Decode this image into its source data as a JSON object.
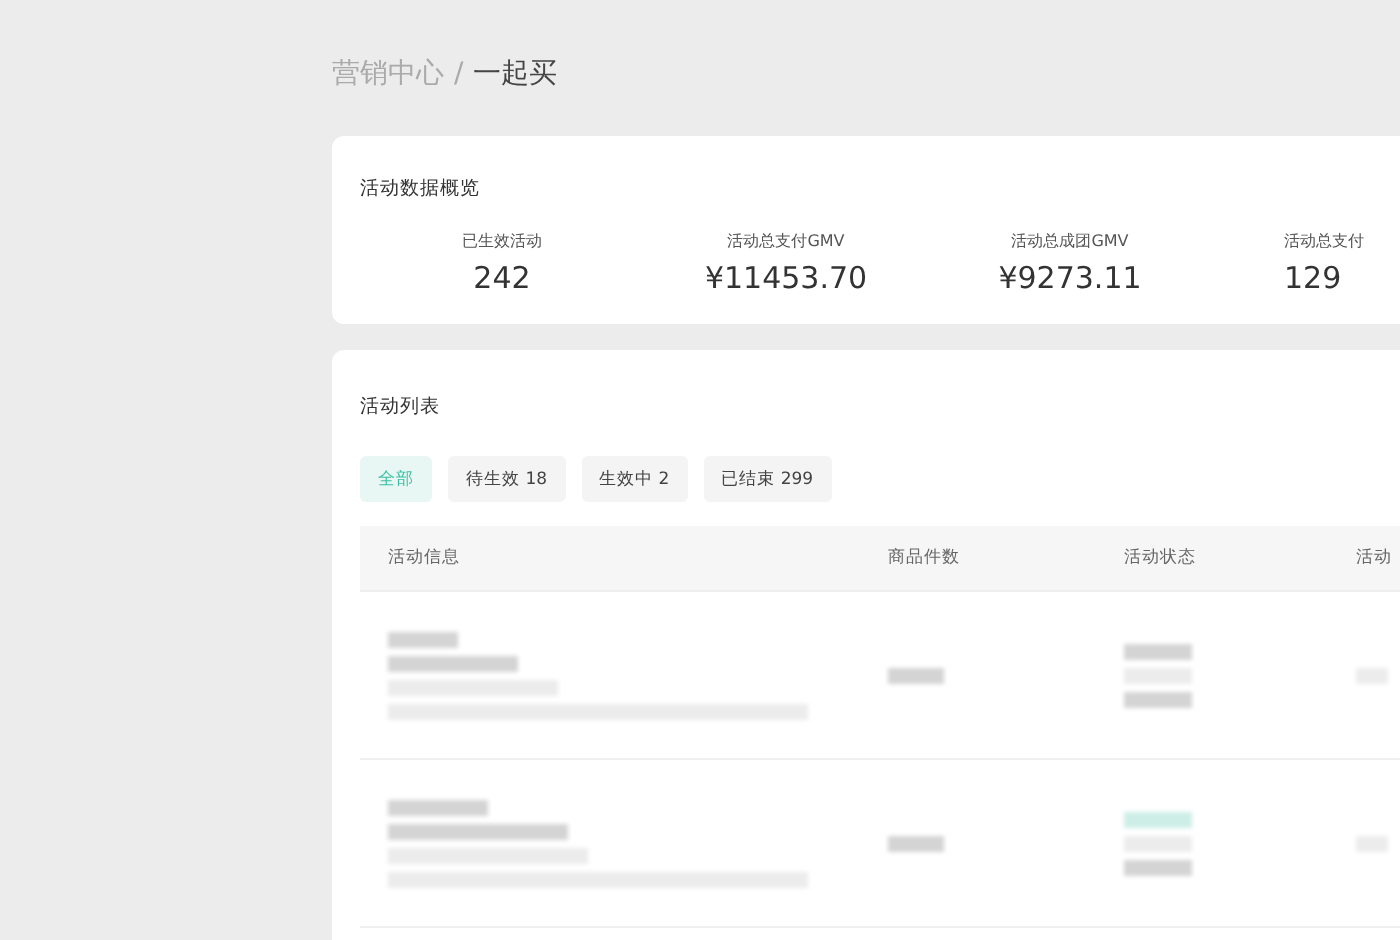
{
  "breadcrumb": {
    "parent": "营销中心",
    "separator": "/",
    "current": "一起买"
  },
  "overview": {
    "title": "活动数据概览",
    "metrics": [
      {
        "label": "已生效活动",
        "value": "242"
      },
      {
        "label": "活动总支付GMV",
        "value": "¥11453.70"
      },
      {
        "label": "活动总成团GMV",
        "value": "¥9273.11"
      },
      {
        "label": "活动总支付",
        "value": "129"
      }
    ]
  },
  "activity_list": {
    "title": "活动列表",
    "filters": [
      {
        "label": "全部",
        "selected": true
      },
      {
        "label": "待生效 18",
        "selected": false
      },
      {
        "label": "生效中 2",
        "selected": false
      },
      {
        "label": "已结束 299",
        "selected": false
      }
    ],
    "table": {
      "columns": [
        "活动信息",
        "商品件数",
        "活动状态",
        "活动"
      ],
      "rows": [
        {
          "kind": "blurred"
        },
        {
          "kind": "blurred"
        }
      ]
    }
  }
}
